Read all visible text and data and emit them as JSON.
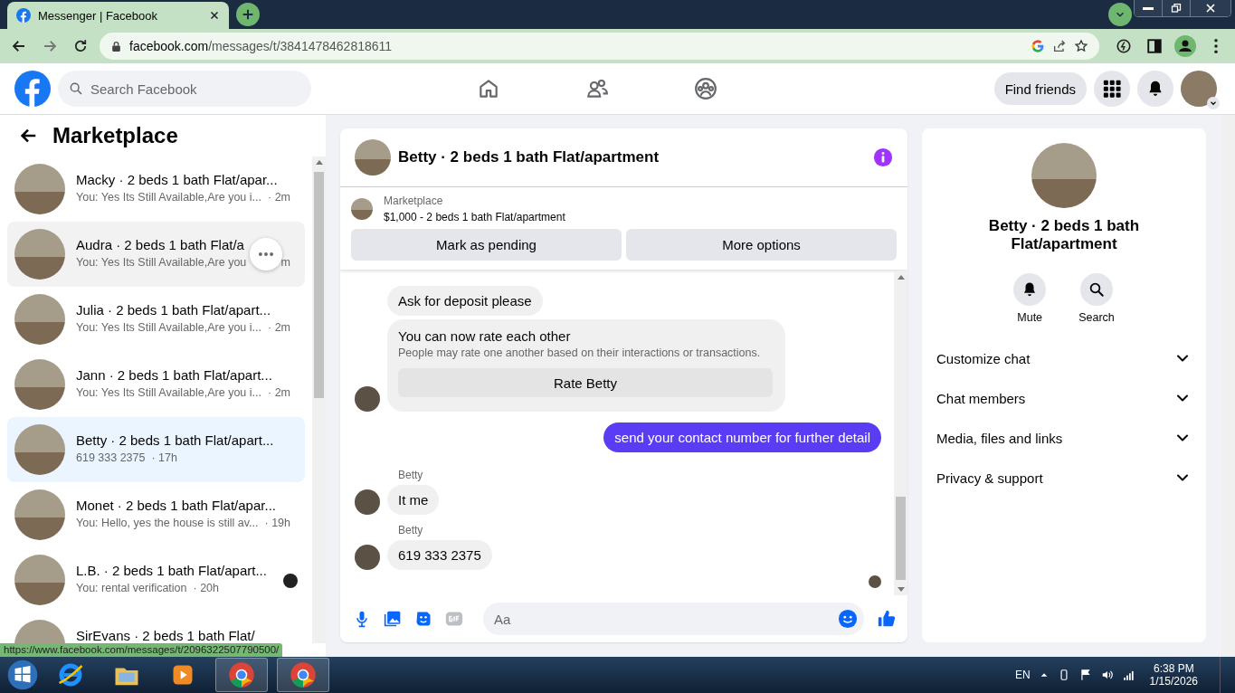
{
  "browser": {
    "tab_title": "Messenger | Facebook",
    "url_host": "facebook.com",
    "url_path": "/messages/t/3841478462818611",
    "status_url": "https://www.facebook.com/messages/t/2096322507790500/"
  },
  "header": {
    "search_placeholder": "Search Facebook",
    "nav": [
      {
        "kind": "home"
      },
      {
        "kind": "friends"
      },
      {
        "kind": "groups"
      }
    ],
    "find_friends": "Find friends"
  },
  "sidebar": {
    "title": "Marketplace",
    "conversations": [
      {
        "name": "Macky · 2 beds 1 bath Flat/apar...",
        "preview": "You: Yes Its Still Available,Are you i...",
        "time": "· 2m",
        "selected": false,
        "hovered": false,
        "seen": false
      },
      {
        "name": "Audra · 2 beds 1 bath Flat/a",
        "preview": "You: Yes Its Still Available,Are you",
        "time": "m",
        "selected": false,
        "hovered": true,
        "seen": false
      },
      {
        "name": "Julia · 2 beds 1 bath Flat/apart...",
        "preview": "You: Yes Its Still Available,Are you i...",
        "time": "· 2m",
        "selected": false,
        "hovered": false,
        "seen": false
      },
      {
        "name": "Jann · 2 beds 1 bath Flat/apart...",
        "preview": "You: Yes Its Still Available,Are you i...",
        "time": "· 2m",
        "selected": false,
        "hovered": false,
        "seen": false
      },
      {
        "name": "Betty · 2 beds 1 bath Flat/apart...",
        "preview": "619 333 2375",
        "time": "· 17h",
        "selected": true,
        "hovered": false,
        "seen": false
      },
      {
        "name": "Monet · 2 beds 1 bath Flat/apar...",
        "preview": "You: Hello, yes the house is still av...",
        "time": "· 19h",
        "selected": false,
        "hovered": false,
        "seen": false
      },
      {
        "name": "L.B. · 2 beds 1 bath Flat/apart...",
        "preview": "You: rental verification",
        "time": "· 20h",
        "selected": false,
        "hovered": false,
        "seen": true
      },
      {
        "name": "SirEvans · 2 beds 1 bath Flat/",
        "selected": false,
        "hovered": false,
        "seen": false
      }
    ]
  },
  "chat": {
    "title": "Betty · 2 beds 1 bath Flat/apartment",
    "listing_label": "Marketplace",
    "listing": "$1,000 - 2 beds 1 bath Flat/apartment",
    "buttons": [
      "Mark as pending",
      "More options"
    ],
    "messages": [
      {
        "kind": "incoming",
        "text": "Ask for deposit please",
        "avatar": false
      },
      {
        "kind": "card",
        "title": "You can now rate each other",
        "text": "People may rate one another based on their interactions or transactions.",
        "button": "Rate Betty",
        "avatar": true
      },
      {
        "kind": "outgoing",
        "text": "send your contact number for further detail"
      },
      {
        "kind": "incoming",
        "sender": "Betty",
        "text": "It me",
        "avatar": true
      },
      {
        "kind": "incoming",
        "sender": "Betty",
        "text": "619 333 2375",
        "avatar": true
      }
    ],
    "seen": true,
    "composer_placeholder": "Aa"
  },
  "info": {
    "name": "Betty · 2 beds 1 bath Flat/apartment",
    "actions": [
      {
        "kind": "mute",
        "label": "Mute"
      },
      {
        "kind": "search",
        "label": "Search"
      }
    ],
    "sections": [
      "Customize chat",
      "Chat members",
      "Media, files and links",
      "Privacy & support"
    ]
  },
  "taskbar": {
    "language": "EN",
    "time": "6:38 PM",
    "date": "1/15/2026"
  }
}
